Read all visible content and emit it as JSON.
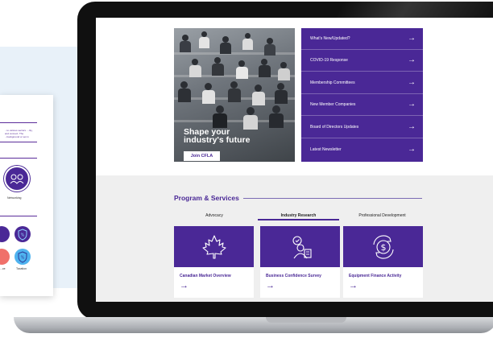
{
  "brochure": {
    "intro_text": "...to various sectors. ...lity, and connect. The ...background or set in",
    "networking_label": "Networking",
    "taxation_label": "Taxation",
    "partial_label": "...ce"
  },
  "hero": {
    "headline_line1": "Shape your",
    "headline_line2": "industry's future",
    "join_button": "Join CFLA"
  },
  "menu": {
    "items": [
      {
        "label": "What's New/Updated?"
      },
      {
        "label": "COVID-19 Response"
      },
      {
        "label": "Membership Committees"
      },
      {
        "label": "New Member Companies"
      },
      {
        "label": "Board of Directors Updates"
      },
      {
        "label": "Latest Newsletter"
      }
    ],
    "arrow": "→"
  },
  "programs": {
    "title": "Program & Services",
    "tabs": [
      {
        "label": "Advocacy",
        "active": false
      },
      {
        "label": "Industry Research",
        "active": true
      },
      {
        "label": "Professional Development",
        "active": false
      }
    ],
    "cards": [
      {
        "title": "Canadian Market Overview",
        "icon": "maple-leaf-icon"
      },
      {
        "title": "Business Confidence Survey",
        "icon": "person-chat-icon"
      },
      {
        "title": "Equipment Finance Activity",
        "icon": "dollar-cycle-icon"
      }
    ],
    "arrow": "→"
  },
  "colors": {
    "brand_purple": "#4a2896",
    "grey_section": "#efefef"
  }
}
